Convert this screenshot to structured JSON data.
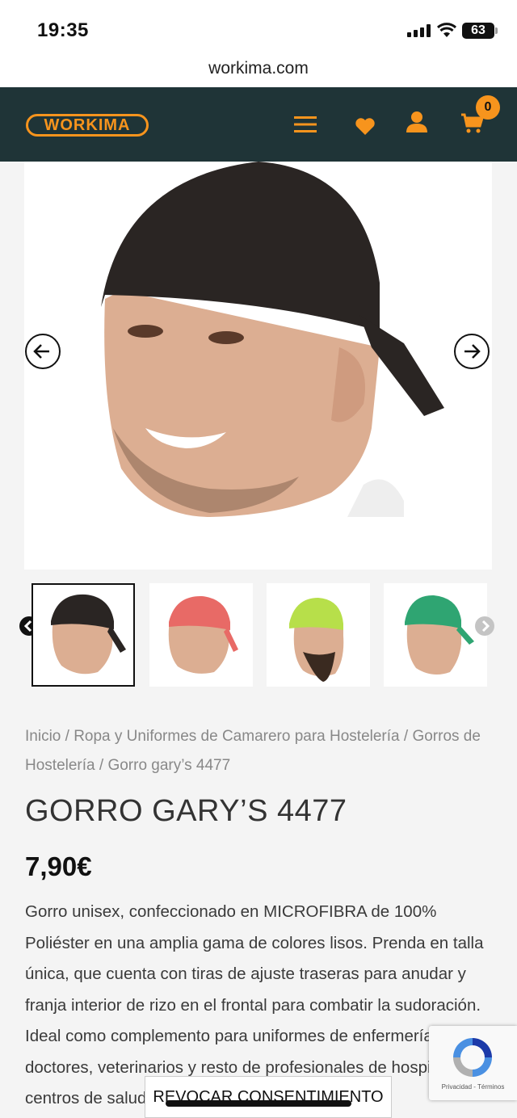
{
  "status": {
    "time": "19:35",
    "battery": "63"
  },
  "browser": {
    "url": "workima.com"
  },
  "header": {
    "logo": "WORKIMA",
    "cart_count": "0",
    "accent": "#f7941d",
    "background": "#1f3437"
  },
  "icons": [
    "menu-icon",
    "heart-icon",
    "user-icon",
    "cart-icon",
    "arrow-left-icon",
    "arrow-right-icon",
    "chevron-left-icon",
    "chevron-right-icon"
  ],
  "gallery": {
    "thumbnails": [
      {
        "cap_color": "#2a2523"
      },
      {
        "cap_color": "#e86a66"
      },
      {
        "cap_color": "#b7df4a"
      },
      {
        "cap_color": "#2fa572"
      }
    ]
  },
  "breadcrumb": {
    "home": "Inicio",
    "separator": " / ",
    "cat1": "Ropa y Uniformes de Camarero para Hostelería",
    "cat2": "Gorros de Hostelería",
    "current": "Gorro gary’s 4477"
  },
  "product": {
    "title": "GORRO GARY’S 4477",
    "price": "7,90€",
    "description": "Gorro unisex, confeccionado en MICROFIBRA de 100% Poliéster en una amplia gama de colores lisos. Prenda en talla única, que cuenta con tiras de ajuste traseras para anudar y franja interior de rizo en el frontal para combatir la sudoración. Ideal como complemento para uniformes de enfermería, doctores, veterinarios y resto de profesionales de hospitales, centros de salud, clínicas o"
  },
  "recaptcha": {
    "links": "Privacidad - Términos"
  },
  "consent": {
    "label": "REVOCAR CONSENTIMIENTO"
  }
}
